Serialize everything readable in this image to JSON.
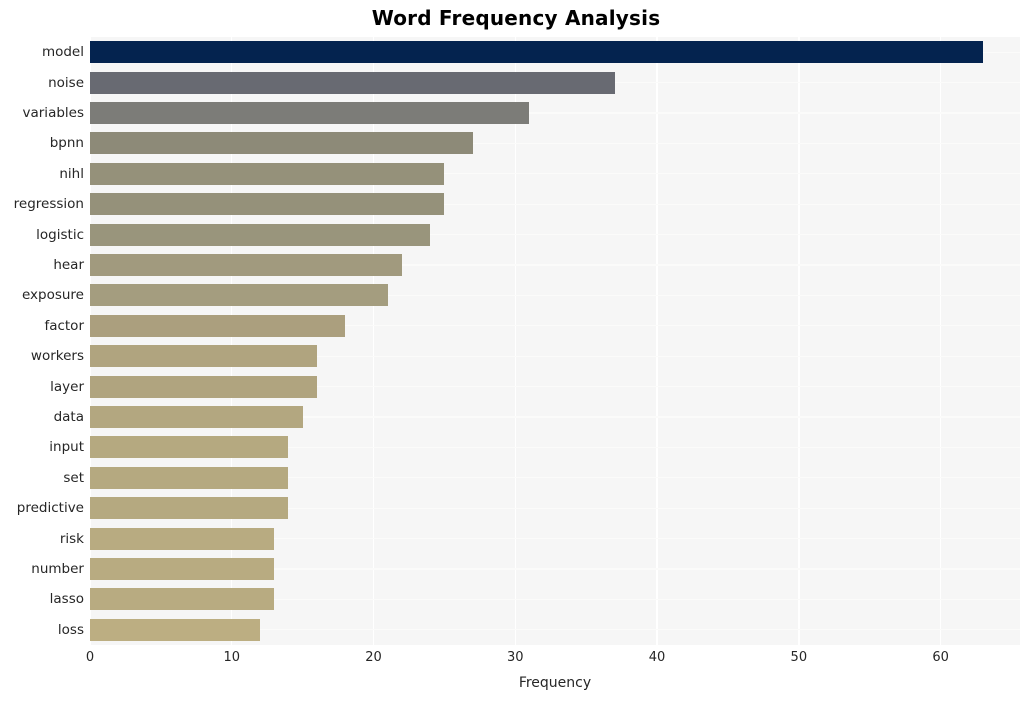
{
  "chart": {
    "title": "Word Frequency Analysis",
    "xlabel": "Frequency",
    "ylabel": ""
  },
  "chart_data": {
    "type": "bar",
    "orientation": "horizontal",
    "title": "Word Frequency Analysis",
    "xlabel": "Frequency",
    "ylabel": "",
    "categories": [
      "model",
      "noise",
      "variables",
      "bpnn",
      "nihl",
      "regression",
      "logistic",
      "hear",
      "exposure",
      "factor",
      "workers",
      "layer",
      "data",
      "input",
      "set",
      "predictive",
      "risk",
      "number",
      "lasso",
      "loss"
    ],
    "values": [
      63,
      37,
      31,
      27,
      25,
      25,
      24,
      22,
      21,
      18,
      16,
      16,
      15,
      14,
      14,
      14,
      13,
      13,
      13,
      12
    ],
    "bar_colors": [
      "#04234f",
      "#686a72",
      "#7c7c78",
      "#8d8a78",
      "#95917a",
      "#95917a",
      "#99957c",
      "#a19a7e",
      "#a49d7f",
      "#ab9f7e",
      "#b0a47f",
      "#b0a47f",
      "#b3a780",
      "#b5a980",
      "#b5a980",
      "#b5a980",
      "#b8ab81",
      "#b8ab81",
      "#b8ab81",
      "#bcae82"
    ],
    "xticks": [
      0,
      10,
      20,
      30,
      40,
      50,
      60
    ],
    "xlim": [
      0,
      65.6
    ],
    "grid": true,
    "grid_axis": "both",
    "legend": "none",
    "colormap": "cividis",
    "plot_background": "#f6f6f6",
    "gridline_color": "#ffffff"
  }
}
